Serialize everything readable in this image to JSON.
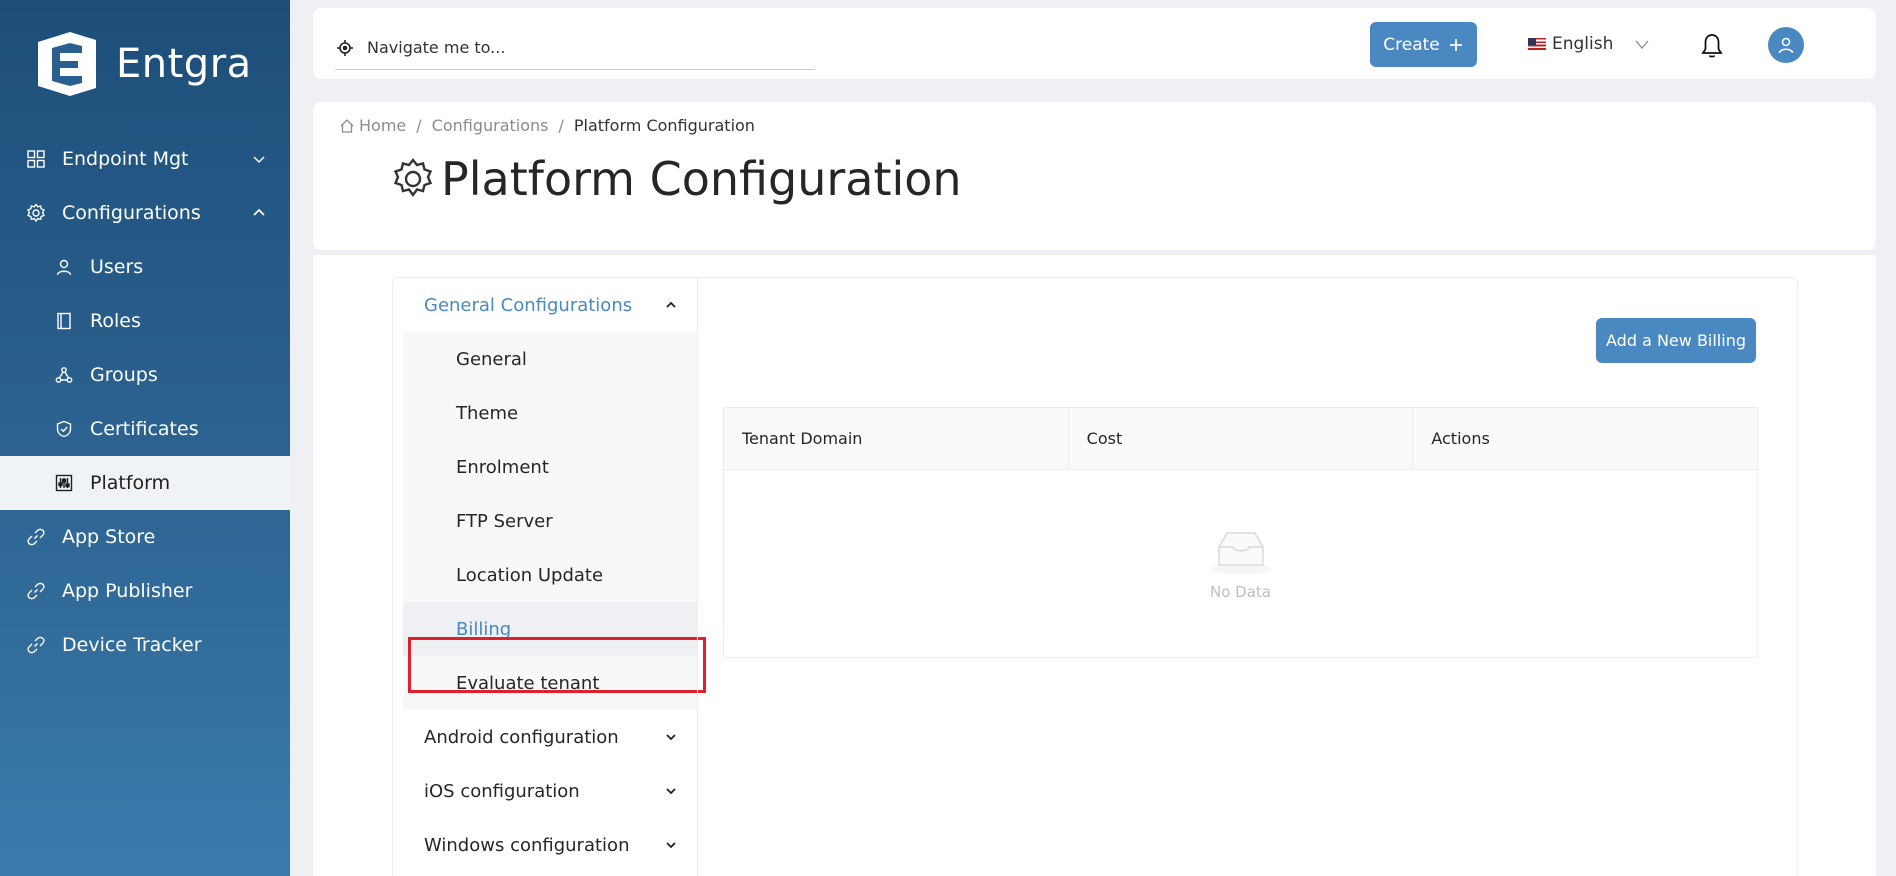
{
  "brand": {
    "name": "Entgra"
  },
  "sidebar": {
    "items": [
      {
        "label": "Endpoint Mgt",
        "icon": "grid-icon",
        "chevron": "down"
      },
      {
        "label": "Configurations",
        "icon": "gear-icon",
        "chevron": "up"
      },
      {
        "label": "Users",
        "icon": "user-icon",
        "sub": true
      },
      {
        "label": "Roles",
        "icon": "book-icon",
        "sub": true
      },
      {
        "label": "Groups",
        "icon": "groups-icon",
        "sub": true
      },
      {
        "label": "Certificates",
        "icon": "shield-icon",
        "sub": true
      },
      {
        "label": "Platform",
        "icon": "sliders-icon",
        "sub": true,
        "active": true
      },
      {
        "label": "App Store",
        "icon": "link-icon"
      },
      {
        "label": "App Publisher",
        "icon": "link-icon"
      },
      {
        "label": "Device Tracker",
        "icon": "link-icon"
      }
    ]
  },
  "header": {
    "search_placeholder": "Navigate me to...",
    "create_label": "Create",
    "language": "English"
  },
  "breadcrumb": {
    "home": "Home",
    "configurations": "Configurations",
    "current": "Platform Configuration"
  },
  "page": {
    "title": "Platform Configuration"
  },
  "config_menu": {
    "general_group": "General Configurations",
    "general_items": [
      "General",
      "Theme",
      "Enrolment",
      "FTP Server",
      "Location Update",
      "Billing",
      "Evaluate tenant"
    ],
    "selected": "Billing",
    "other_groups": [
      "Android configuration",
      "iOS configuration",
      "Windows configuration"
    ]
  },
  "billing": {
    "add_button": "Add a New Billing",
    "columns": [
      "Tenant Domain",
      "Cost",
      "Actions"
    ],
    "empty_text": "No Data"
  },
  "colors": {
    "accent": "#4a88c1",
    "sidebar": "#1d4e79",
    "highlight": "#e0202a"
  }
}
